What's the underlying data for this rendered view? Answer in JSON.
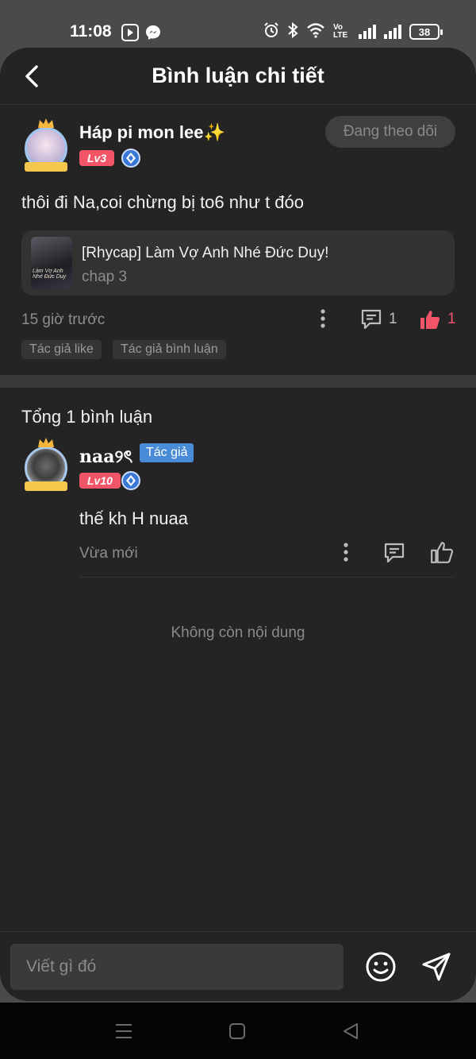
{
  "status_bar": {
    "time": "11:08",
    "network_label": "Vo LTE",
    "battery": "38"
  },
  "header": {
    "title": "Bình luận chi tiết"
  },
  "post": {
    "username": "Háp pi mon lee✨",
    "level": "Lv3",
    "follow_label": "Đang theo dõi",
    "text": "thôi đi Na,coi chừng bị to6 như t đóo",
    "chapter_card": {
      "title": "[Rhycap] Làm Vợ Anh Nhé Đức Duy!",
      "subtitle": "chap 3",
      "thumb_text": "Làm Vợ Anh Nhé Đức Duy"
    },
    "time": "15 giờ trước",
    "comment_count": "1",
    "like_count": "1",
    "tags": [
      "Tác giả like",
      "Tác giả bình luận"
    ]
  },
  "comments": {
    "total_label": "Tổng 1 bình luận",
    "items": [
      {
        "username": "naa୨ৎ",
        "author_tag": "Tác giả",
        "level": "Lv10",
        "text": "thế kh H nuaa",
        "time": "Vừa mới"
      }
    ],
    "no_more_label": "Không còn nội dung"
  },
  "input": {
    "placeholder": "Viết gì đó"
  },
  "colors": {
    "background": "#242424",
    "level_badge": "#f25567",
    "author_tag": "#4a8bd8",
    "like_active": "#f25567"
  }
}
